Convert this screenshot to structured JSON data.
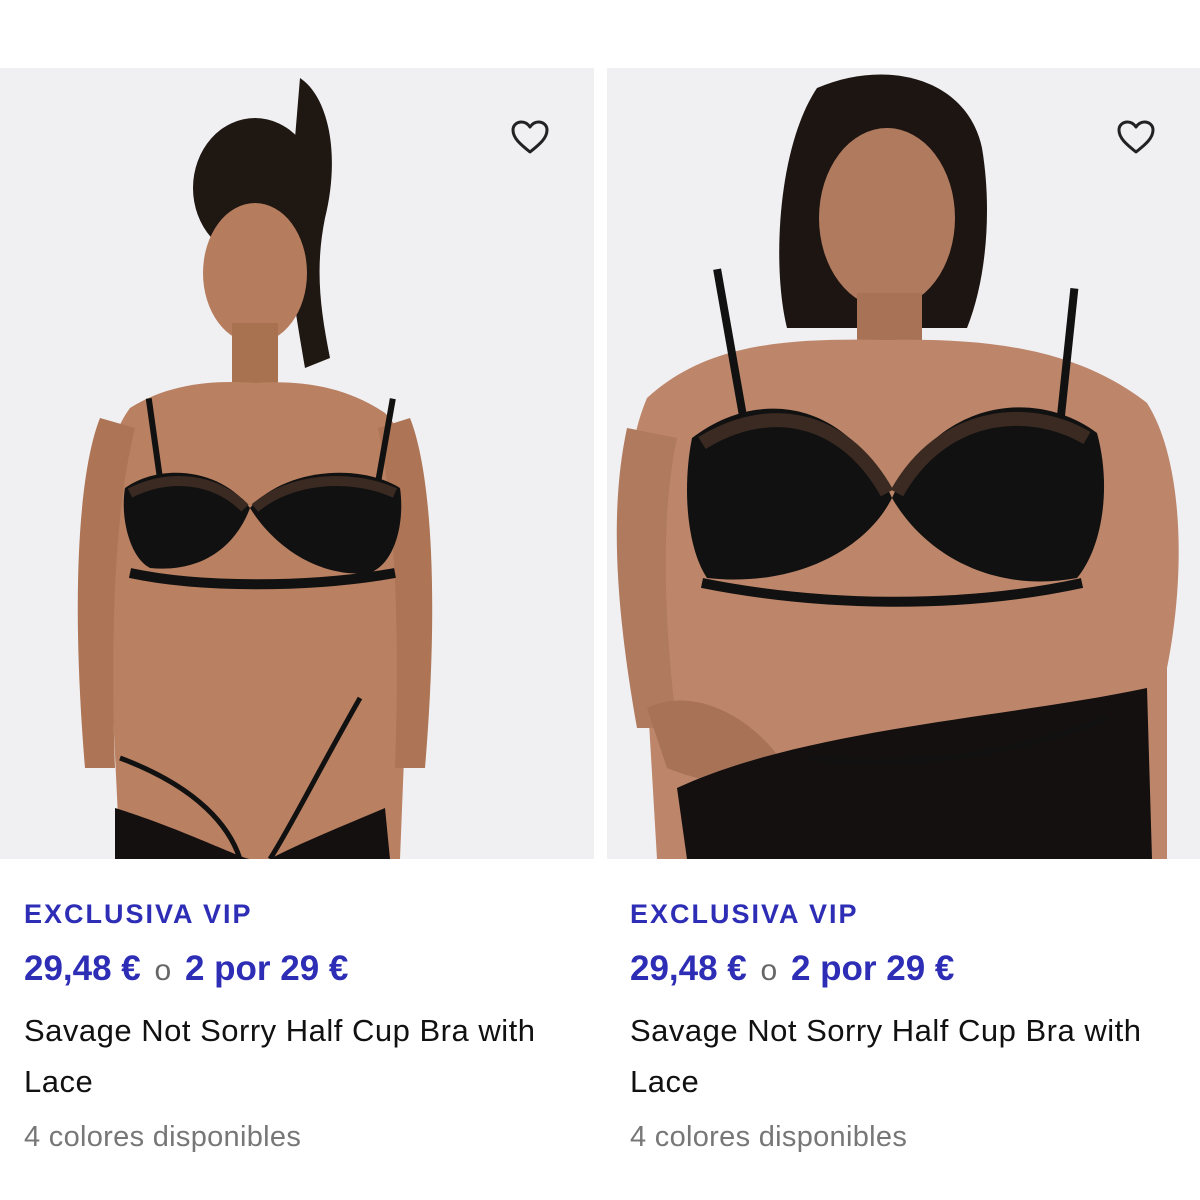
{
  "products": [
    {
      "badge": "EXCLUSIVA VIP",
      "price": "29,48 €",
      "separator": "o",
      "promo": "2 por 29 €",
      "title": "Savage Not Sorry Half Cup Bra with Lace",
      "colors": "4 colores disponibles",
      "wishlist_icon": "heart-outline-icon"
    },
    {
      "badge": "EXCLUSIVA VIP",
      "price": "29,48 €",
      "separator": "o",
      "promo": "2 por 29 €",
      "title": "Savage Not Sorry Half Cup Bra with Lace",
      "colors": "4 colores disponibles",
      "wishlist_icon": "heart-outline-icon"
    }
  ],
  "colors": {
    "accent": "#2d2db5",
    "text": "#111111",
    "muted": "#777777",
    "photo_background": "#f0f0f3"
  }
}
